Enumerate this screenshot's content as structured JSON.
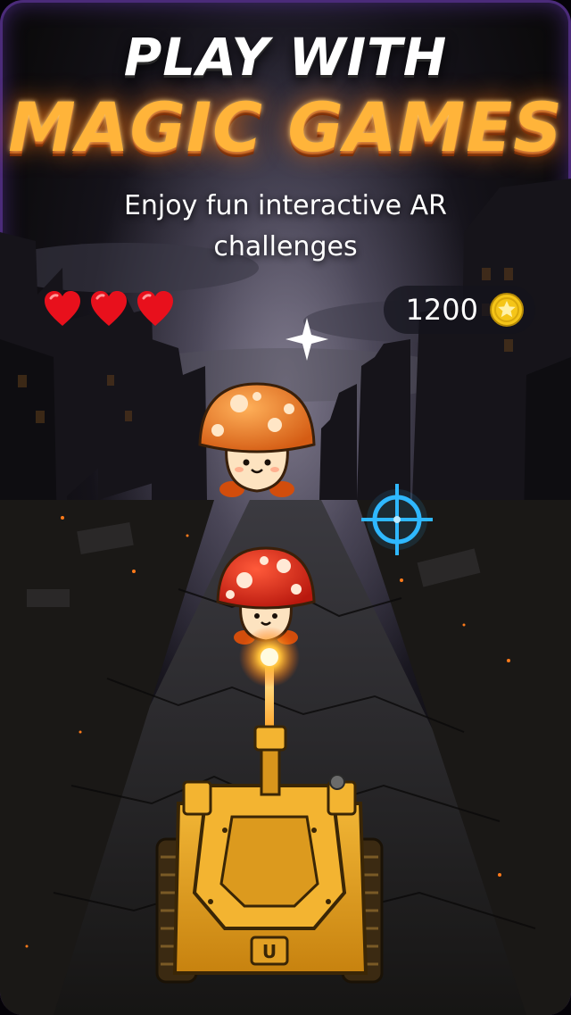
{
  "header": {
    "title_line1": "PLAY WITH",
    "title_line2": "MAGIC GAMES",
    "subtitle": "Enjoy fun interactive AR challenges"
  },
  "hud": {
    "lives_remaining": 3,
    "score": "1200"
  },
  "game_objects": {
    "enemies": [
      "orange-mushroom",
      "red-mushroom"
    ],
    "player": "tank",
    "tank_badge": "U"
  },
  "colors": {
    "title_accent": "#ffb43a",
    "crosshair": "#2fb8ff",
    "heart": "#e8101c",
    "coin": "#f5c518",
    "tank_body": "#e4a020",
    "frame_glow": "#8c50ff"
  }
}
